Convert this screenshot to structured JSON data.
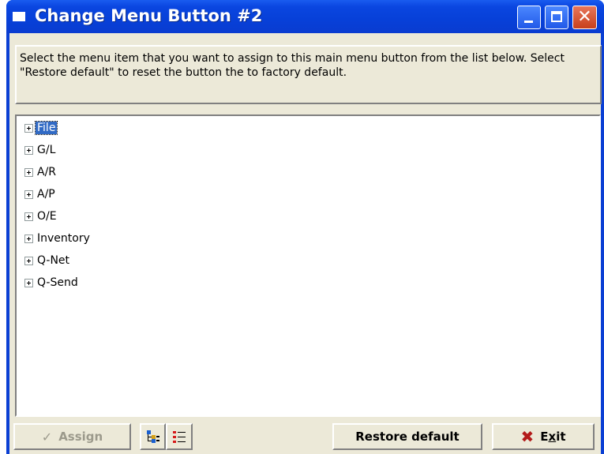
{
  "window": {
    "title": "Change Menu Button #2"
  },
  "instructions": "Select the menu item that you want to assign to this main menu button from the list below.  Select \"Restore default\" to reset the button the to factory default.",
  "tree": {
    "items": [
      {
        "label": "File",
        "selected": true
      },
      {
        "label": "G/L"
      },
      {
        "label": "A/R"
      },
      {
        "label": "A/P"
      },
      {
        "label": "O/E"
      },
      {
        "label": "Inventory"
      },
      {
        "label": "Q-Net"
      },
      {
        "label": "Q-Send"
      }
    ]
  },
  "buttons": {
    "assign": "Assign",
    "restore_default": "Restore default",
    "exit_prefix": "E",
    "exit_mnemonic": "x",
    "exit_suffix": "it"
  },
  "icons": {
    "assign": "checkmark-icon",
    "expand_tree": "tree-view-icon",
    "list": "list-view-icon",
    "exit": "red-x-icon"
  },
  "colors": {
    "titlebar": "#0a46e0",
    "selection": "#316ac5",
    "dialog_face": "#ece9d8",
    "close_button": "#c7401c"
  }
}
